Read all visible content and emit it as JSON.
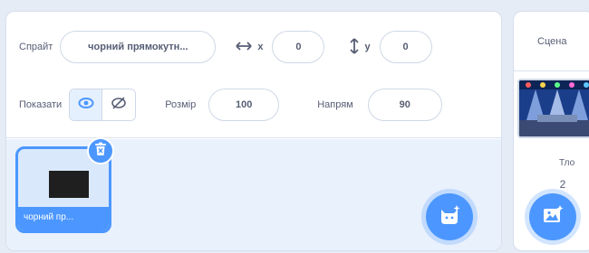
{
  "sprite_info": {
    "sprite_label": "Спрайт",
    "sprite_name_value": "чорний прямокутн...",
    "x_label": "x",
    "x_value": "0",
    "y_label": "y",
    "y_value": "0",
    "show_label": "Показати",
    "size_label": "Розмір",
    "size_value": "100",
    "direction_label": "Напрям",
    "direction_value": "90"
  },
  "sprite_list": {
    "items": [
      {
        "name": "чорний пр...",
        "selected": true
      }
    ]
  },
  "stage": {
    "tab_label": "Сцена",
    "backdrops_label": "Тло",
    "backdrops_count": "2"
  },
  "colors": {
    "accent": "#4c97ff",
    "text": "#575e75",
    "pane_bg": "#e9f1fc"
  }
}
